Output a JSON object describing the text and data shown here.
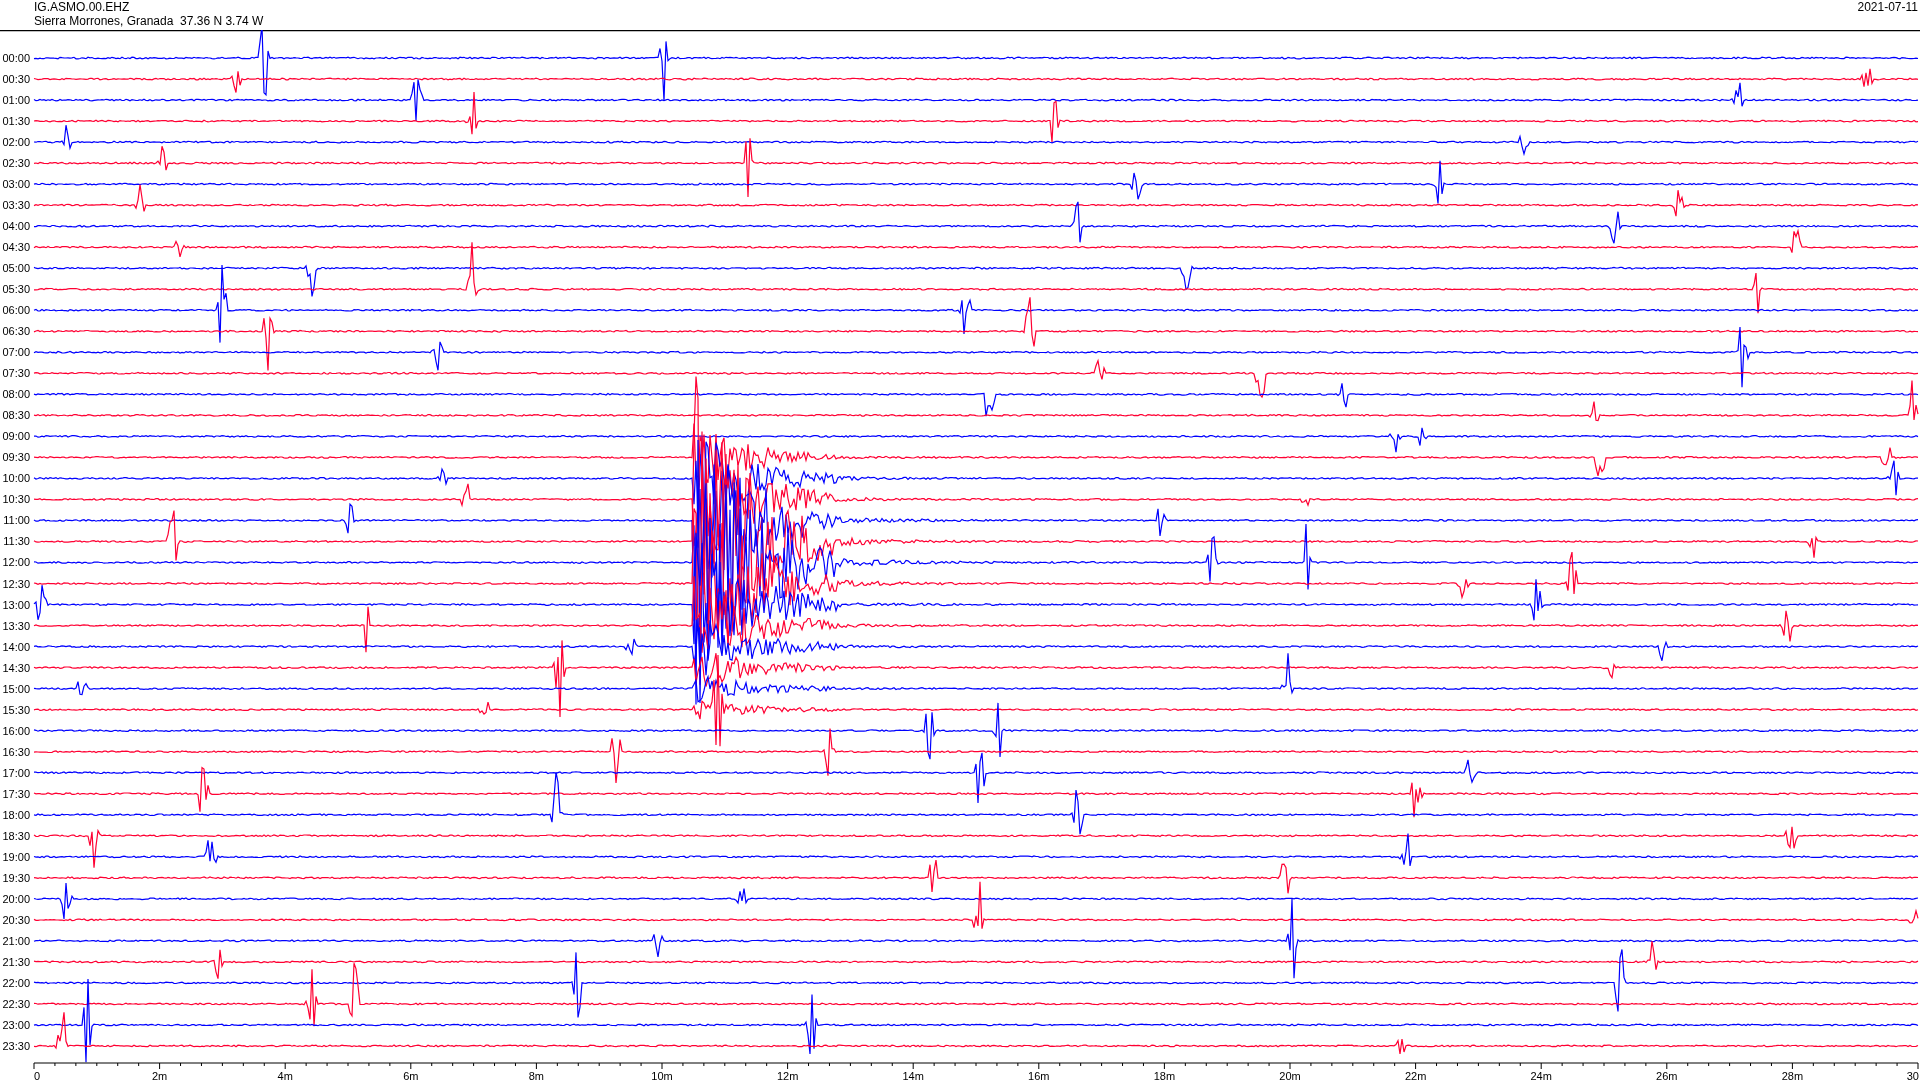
{
  "header": {
    "station": "IG.ASMO.00.EHZ",
    "location": "Sierra Morrones, Granada  37.36 N 3.74 W",
    "date": "2021-07-11"
  },
  "traces": [
    {
      "time": "00:00",
      "color": "#0000ff"
    },
    {
      "time": "00:30",
      "color": "#ff0033"
    },
    {
      "time": "01:00",
      "color": "#0000ff"
    },
    {
      "time": "01:30",
      "color": "#ff0033"
    },
    {
      "time": "02:00",
      "color": "#0000ff"
    },
    {
      "time": "02:30",
      "color": "#ff0033"
    },
    {
      "time": "03:00",
      "color": "#0000ff"
    },
    {
      "time": "03:30",
      "color": "#ff0033"
    },
    {
      "time": "04:00",
      "color": "#0000ff"
    },
    {
      "time": "04:30",
      "color": "#ff0033"
    },
    {
      "time": "05:00",
      "color": "#0000ff"
    },
    {
      "time": "05:30",
      "color": "#ff0033"
    },
    {
      "time": "06:00",
      "color": "#0000ff"
    },
    {
      "time": "06:30",
      "color": "#ff0033"
    },
    {
      "time": "07:00",
      "color": "#0000ff"
    },
    {
      "time": "07:30",
      "color": "#ff0033"
    },
    {
      "time": "08:00",
      "color": "#0000ff"
    },
    {
      "time": "08:30",
      "color": "#ff0033"
    },
    {
      "time": "09:00",
      "color": "#0000ff"
    },
    {
      "time": "09:30",
      "color": "#ff0033"
    },
    {
      "time": "10:00",
      "color": "#0000ff"
    },
    {
      "time": "10:30",
      "color": "#ff0033"
    },
    {
      "time": "11:00",
      "color": "#0000ff"
    },
    {
      "time": "11:30",
      "color": "#ff0033"
    },
    {
      "time": "12:00",
      "color": "#0000ff"
    },
    {
      "time": "12:30",
      "color": "#ff0033"
    },
    {
      "time": "13:00",
      "color": "#0000ff"
    },
    {
      "time": "13:30",
      "color": "#ff0033"
    },
    {
      "time": "14:00",
      "color": "#0000ff"
    },
    {
      "time": "14:30",
      "color": "#ff0033"
    },
    {
      "time": "15:00",
      "color": "#0000ff"
    },
    {
      "time": "15:30",
      "color": "#ff0033"
    },
    {
      "time": "16:00",
      "color": "#0000ff"
    },
    {
      "time": "16:30",
      "color": "#ff0033"
    },
    {
      "time": "17:00",
      "color": "#0000ff"
    },
    {
      "time": "17:30",
      "color": "#ff0033"
    },
    {
      "time": "18:00",
      "color": "#0000ff"
    },
    {
      "time": "18:30",
      "color": "#ff0033"
    },
    {
      "time": "19:00",
      "color": "#0000ff"
    },
    {
      "time": "19:30",
      "color": "#ff0033"
    },
    {
      "time": "20:00",
      "color": "#0000ff"
    },
    {
      "time": "20:30",
      "color": "#ff0033"
    },
    {
      "time": "21:00",
      "color": "#0000ff"
    },
    {
      "time": "21:30",
      "color": "#ff0033"
    },
    {
      "time": "22:00",
      "color": "#0000ff"
    },
    {
      "time": "22:30",
      "color": "#ff0033"
    },
    {
      "time": "23:00",
      "color": "#0000ff"
    },
    {
      "time": "23:30",
      "color": "#ff0033"
    }
  ],
  "x_axis": {
    "ticks": [
      "0",
      "2m",
      "4m",
      "6m",
      "8m",
      "10m",
      "12m",
      "14m",
      "16m",
      "18m",
      "20m",
      "22m",
      "24m",
      "26m",
      "28m",
      "30"
    ]
  }
}
